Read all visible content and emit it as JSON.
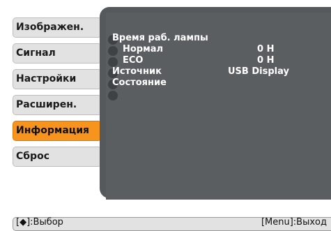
{
  "menu": {
    "items": [
      {
        "label": "Изображен."
      },
      {
        "label": "Сигнал"
      },
      {
        "label": "Настройки"
      },
      {
        "label": "Расширен."
      },
      {
        "label": "Информация"
      },
      {
        "label": "Сброс"
      }
    ],
    "active_index": 4
  },
  "info": {
    "lamp_hours_label": "Время раб. лампы",
    "normal_label": "Нормал",
    "normal_value": "0 H",
    "eco_label": "ECO",
    "eco_value": "0 H",
    "source_label": "Источник",
    "source_value": "USB Display",
    "status_label": "Состояние"
  },
  "footer": {
    "select_hint": "[◆]:Выбор",
    "exit_hint": "[Menu]:Выход"
  },
  "colors": {
    "active_menu": "#f7941d",
    "menu_bg": "#e2e2e2",
    "panel_bg": "#56595c"
  }
}
